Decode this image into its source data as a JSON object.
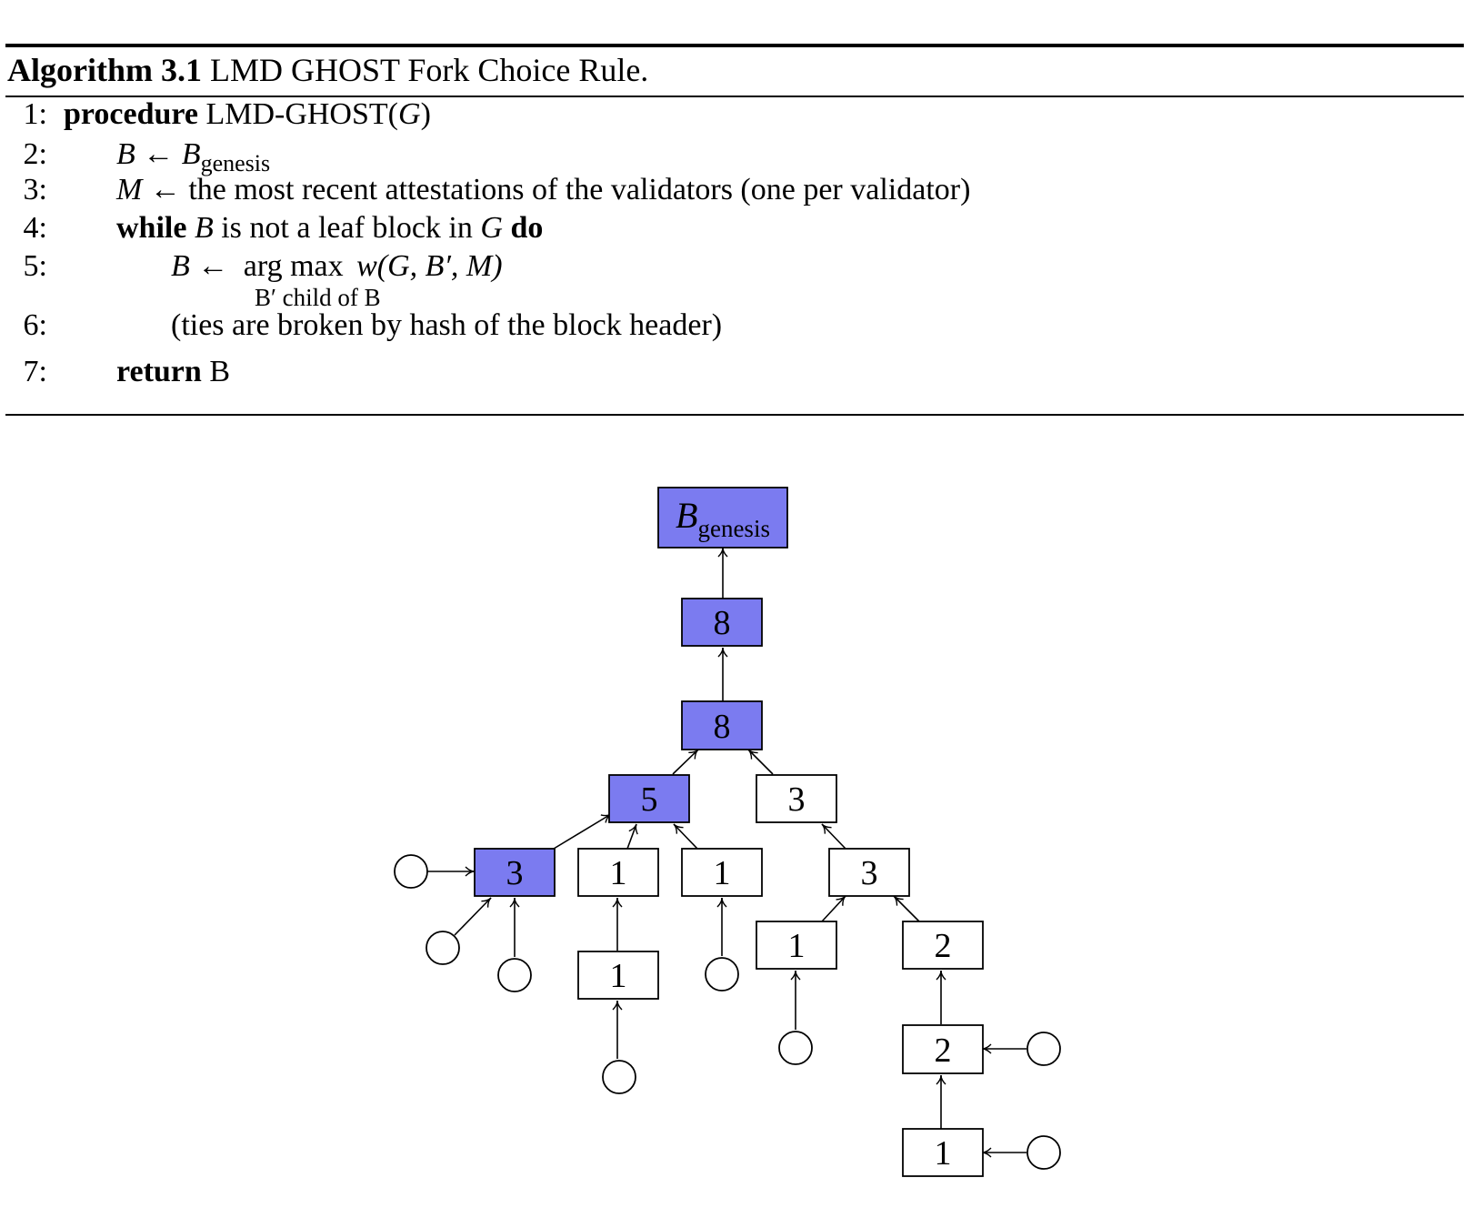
{
  "algorithm": {
    "label": "Algorithm 3.1",
    "title": "LMD GHOST Fork Choice Rule.",
    "lines": [
      {
        "num": "1:",
        "kw": "procedure",
        "name": "LMD-GHOST(",
        "arg": "G",
        "close": ")"
      },
      {
        "num": "2:",
        "lhs": "B",
        "arrow": "←",
        "rhs": "B",
        "sub": "genesis"
      },
      {
        "num": "3:",
        "lhs": "M",
        "arrow": "←",
        "text": "the most recent attestations of the validators (one per validator)"
      },
      {
        "num": "4:",
        "kw": "while",
        "var": "B",
        "text": "is not a leaf block in",
        "var2": "G",
        "kw2": "do"
      },
      {
        "num": "5:",
        "lhs": "B",
        "arrow": "←",
        "op": "arg max",
        "expr": "w(G, B′, M)",
        "under": "B′ child of B"
      },
      {
        "num": "6:",
        "text": "(ties are broken by hash of the block header)"
      },
      {
        "num": "7:",
        "kw": "return",
        "text": "B"
      }
    ]
  },
  "tree": {
    "highlight_color": "#7b7bf0",
    "genesis": {
      "main": "B",
      "sub": "genesis"
    },
    "nodes": [
      {
        "id": "n8a",
        "label": "8",
        "hl": true
      },
      {
        "id": "n8b",
        "label": "8",
        "hl": true
      },
      {
        "id": "n5",
        "label": "5",
        "hl": true
      },
      {
        "id": "n3r",
        "label": "3",
        "hl": false
      },
      {
        "id": "n3l",
        "label": "3",
        "hl": true
      },
      {
        "id": "n1a",
        "label": "1",
        "hl": false
      },
      {
        "id": "n1b",
        "label": "1",
        "hl": false
      },
      {
        "id": "n3rr",
        "label": "3",
        "hl": false
      },
      {
        "id": "n1c",
        "label": "1",
        "hl": false
      },
      {
        "id": "n1d",
        "label": "1",
        "hl": false
      },
      {
        "id": "n2a",
        "label": "2",
        "hl": false
      },
      {
        "id": "n2b",
        "label": "2",
        "hl": false
      },
      {
        "id": "n1e",
        "label": "1",
        "hl": false
      }
    ]
  }
}
